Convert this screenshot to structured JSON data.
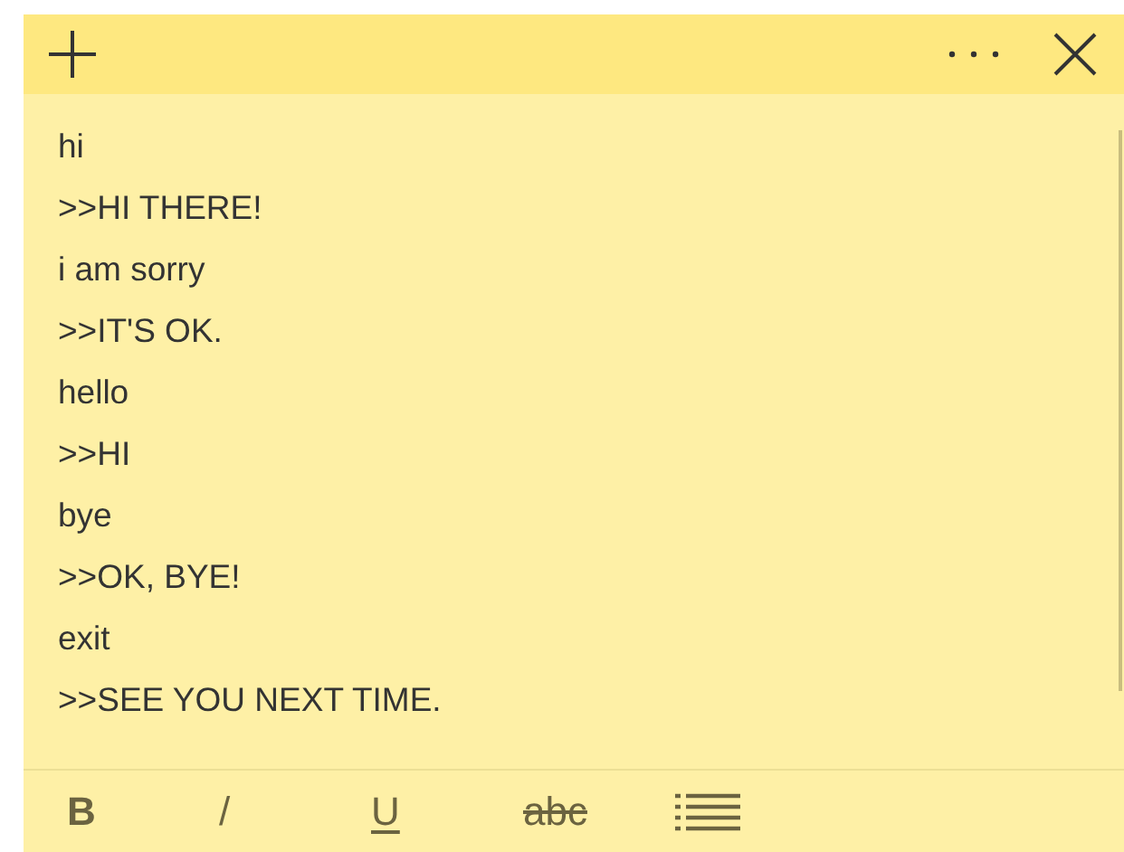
{
  "note": {
    "lines": [
      "hi",
      ">>HI THERE!",
      "i am sorry",
      ">>IT'S OK.",
      "hello",
      ">>HI",
      "bye",
      ">>OK, BYE!",
      "exit",
      ">>SEE YOU NEXT TIME."
    ]
  },
  "toolbar": [
    {
      "kind": "bold",
      "label": "B"
    },
    {
      "kind": "italic",
      "label": "/"
    },
    {
      "kind": "underline",
      "label": "U"
    },
    {
      "kind": "strike",
      "label": "abc"
    },
    {
      "kind": "list"
    }
  ]
}
